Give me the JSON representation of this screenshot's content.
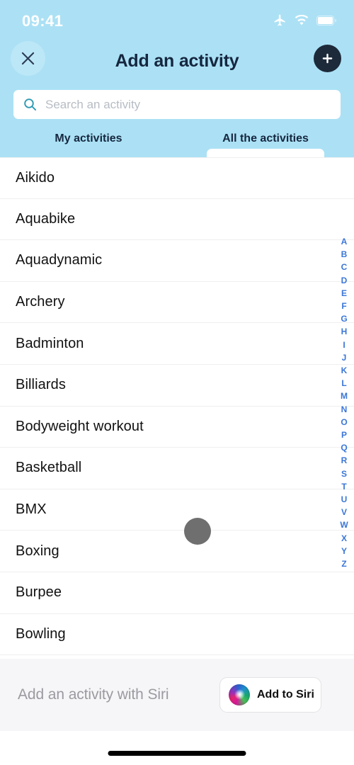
{
  "status_bar": {
    "time": "09:41",
    "icons": [
      "airplane-icon",
      "wifi-icon",
      "battery-icon"
    ]
  },
  "header": {
    "title": "Add an activity",
    "close_icon": "close-icon",
    "add_icon": "plus-icon",
    "background_color": "#ace1f5",
    "title_color": "#15273f"
  },
  "search": {
    "icon": "search-icon",
    "value": "",
    "placeholder": "Search an activity"
  },
  "tabs": {
    "items": [
      {
        "label": "My activities",
        "active": false
      },
      {
        "label": "All the activities",
        "active": true
      }
    ]
  },
  "activity_list": {
    "items": [
      {
        "label": "Aikido"
      },
      {
        "label": "Aquabike"
      },
      {
        "label": "Aquadynamic"
      },
      {
        "label": "Archery"
      },
      {
        "label": "Badminton"
      },
      {
        "label": "Billiards"
      },
      {
        "label": "Bodyweight workout"
      },
      {
        "label": "Basketball"
      },
      {
        "label": "BMX"
      },
      {
        "label": "Boxing"
      },
      {
        "label": "Burpee"
      },
      {
        "label": "Bowling"
      }
    ]
  },
  "alphabet_index": {
    "color": "#3b76d8",
    "letters": [
      "A",
      "B",
      "C",
      "D",
      "E",
      "F",
      "G",
      "H",
      "I",
      "J",
      "K",
      "L",
      "M",
      "N",
      "O",
      "P",
      "Q",
      "R",
      "S",
      "T",
      "U",
      "V",
      "W",
      "X",
      "Y",
      "Z"
    ]
  },
  "touch_indicator": {
    "color": "#6f6f6f"
  },
  "siri_footer": {
    "label": "Add an activity with Siri",
    "button_label": "Add to Siri",
    "orb_icon": "siri-orb-icon",
    "background_color": "#f6f6f8"
  },
  "home_indicator": {
    "color": "#000000"
  }
}
